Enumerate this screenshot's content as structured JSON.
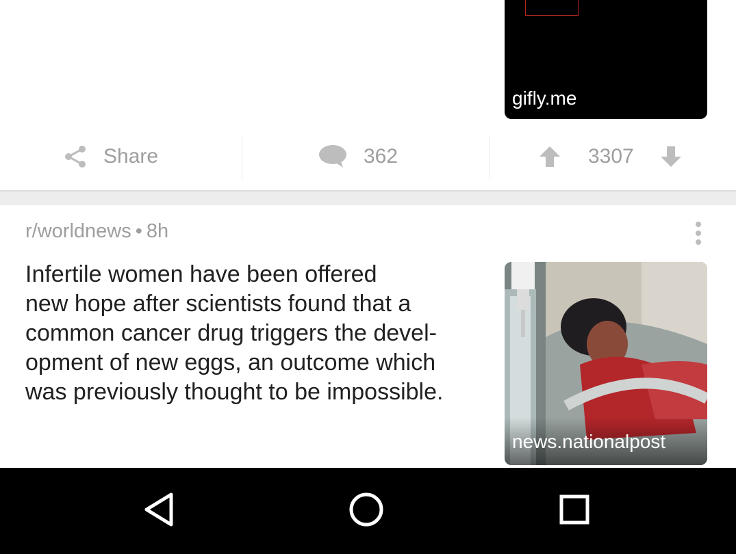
{
  "top_post": {
    "thumbnail_domain": "gifly.me"
  },
  "actions": {
    "share_label": "Share",
    "comment_count": "362",
    "score": "3307",
    "share_icon": "share-icon",
    "comment_icon": "comment-icon",
    "upvote_icon": "upvote-arrow-icon",
    "downvote_icon": "downvote-arrow-icon"
  },
  "post": {
    "subreddit": "r/worldnews",
    "separator": "•",
    "age": "8h",
    "title": "Infertile women have been offered\nnew hope after scientists found that a\ncommon cancer drug triggers the devel-\nopment of new eggs, an outcome which\nwas previously thought to be impossible.",
    "thumbnail_domain": "news.nationalpost",
    "menu_icon": "overflow-menu-icon"
  },
  "nav_bar": {
    "back_icon": "back-icon",
    "home_icon": "home-icon",
    "recents_icon": "recents-icon"
  },
  "colors": {
    "muted_text": "#9e9e9e",
    "title_text": "#212121",
    "separator": "#ededed",
    "nav_background": "#000000"
  }
}
